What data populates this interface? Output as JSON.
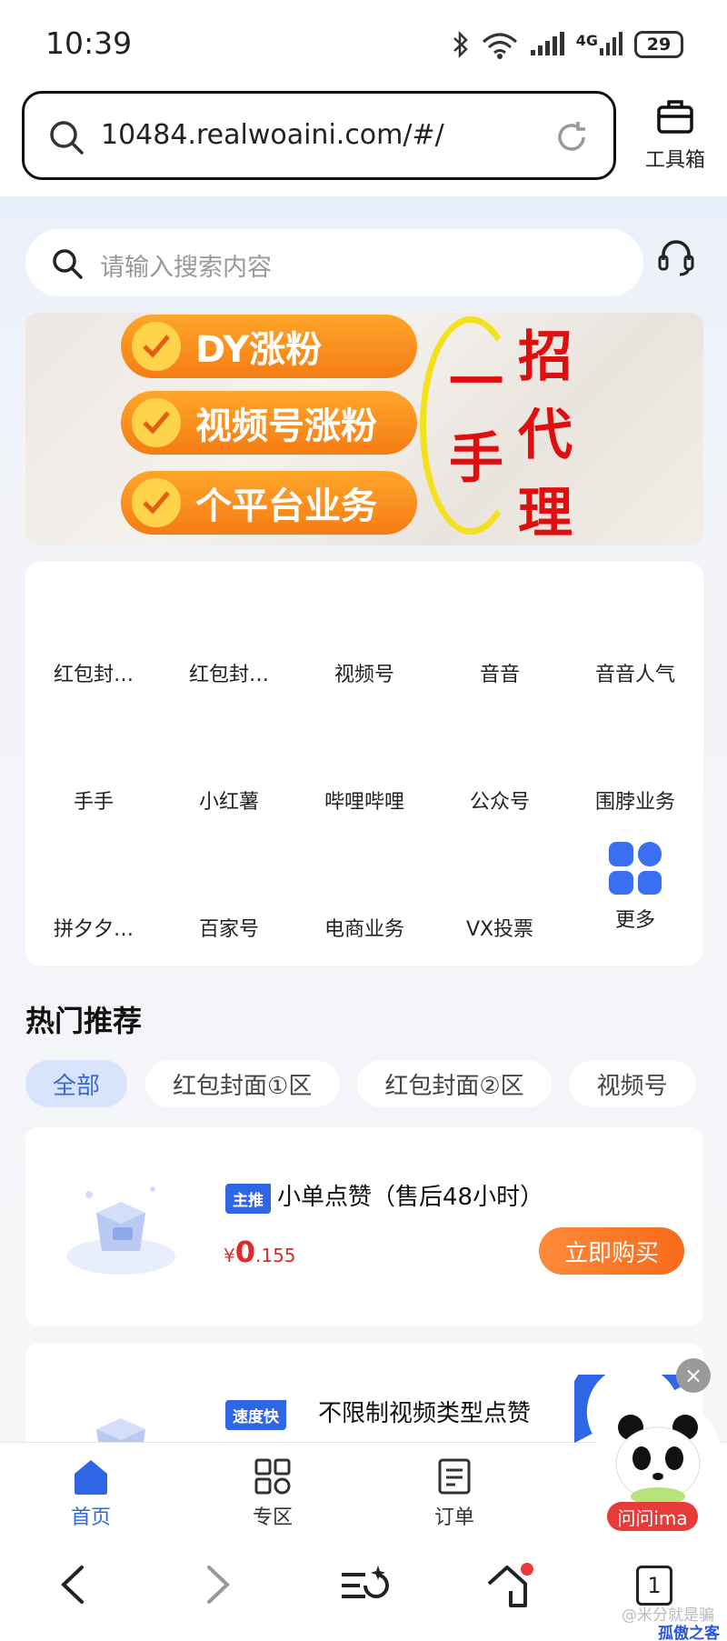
{
  "status_bar": {
    "time": "10:39",
    "network_label": "4G",
    "signal_sup": "6",
    "battery": "29"
  },
  "url_bar": {
    "url": "10484.realwoaini.com/#/",
    "toolbox_label": "工具箱"
  },
  "search": {
    "placeholder": "请输入搜索内容"
  },
  "banner": {
    "pills": [
      "DY涨粉",
      "视频号涨粉",
      "个平台业务"
    ],
    "big_chars": [
      "一",
      "招",
      "代",
      "手",
      "理"
    ]
  },
  "categories": [
    "红包封…",
    "红包封…",
    "视频号",
    "音音",
    "音音人气",
    "手手",
    "小红薯",
    "哔哩哔哩",
    "公众号",
    "围脖业务",
    "拼夕夕…",
    "百家号",
    "电商业务",
    "VX投票",
    "更多"
  ],
  "hot": {
    "title": "热门推荐",
    "tabs": [
      "全部",
      "红包封面①区",
      "红包封面②区",
      "视频号"
    ]
  },
  "products": [
    {
      "tag": "主推",
      "name": "小单点赞（售后48小时）",
      "currency": "¥",
      "price_int": "0",
      "price_dec": ".155",
      "buy_label": "立即购买"
    },
    {
      "tag": "速度快",
      "name": "不限制视频类型点赞"
    }
  ],
  "bottom_nav": [
    "首页",
    "专区",
    "订单"
  ],
  "assistant": {
    "label": "问问ima",
    "close": "×"
  },
  "browser_bar": {
    "tab_count": "1"
  },
  "watermark": {
    "line1": "@米分就是骗",
    "line2": "孤傲之客"
  },
  "colors": {
    "accent_blue": "#2f66e6",
    "buy_orange": "#f66a1a",
    "price_red": "#e02b2b"
  }
}
